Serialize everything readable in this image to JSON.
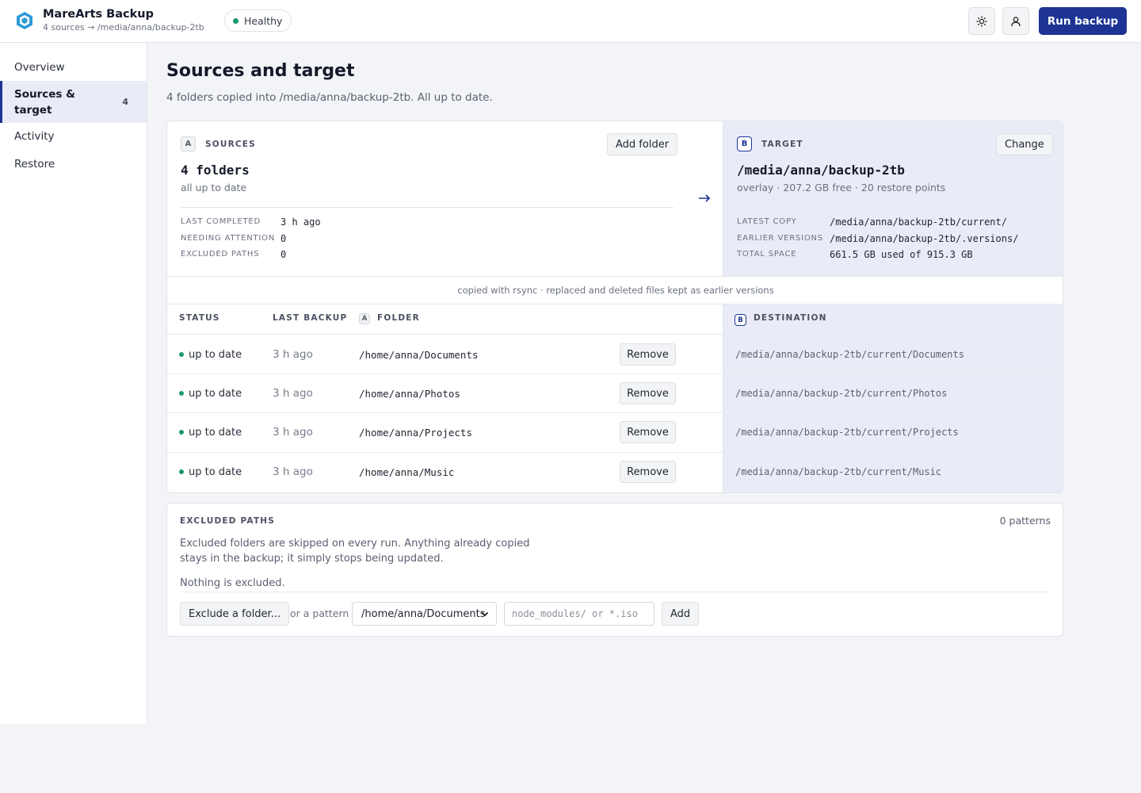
{
  "app": {
    "title": "MareArts Backup",
    "subtitle": "4 sources → /media/anna/backup-2tb",
    "health": "Healthy",
    "run_label": "Run backup"
  },
  "icons": {
    "logo": "cube-logo-icon",
    "theme": "sun-icon",
    "account": "user-icon",
    "arrow": "arrow-right-icon",
    "select": "chevron-down-icon"
  },
  "colors": {
    "accent": "#1d3494",
    "ok": "#1a9a6a",
    "target_bg": "#e9ecf6"
  },
  "sidebar": {
    "items": [
      {
        "label": "Overview"
      },
      {
        "label": "Sources & target",
        "count": "4"
      },
      {
        "label": "Activity"
      },
      {
        "label": "Restore"
      }
    ]
  },
  "page": {
    "title": "Sources and target",
    "subtitle": "4 folders copied into /media/anna/backup-2tb. All up to date."
  },
  "sources": {
    "badge": "A",
    "caption": "SOURCES",
    "add_label": "Add folder",
    "headline": "4 folders",
    "sub": "all up to date",
    "stats": [
      {
        "label": "LAST COMPLETED",
        "value": "3 h ago"
      },
      {
        "label": "NEEDING ATTENTION",
        "value": "0"
      },
      {
        "label": "EXCLUDED PATHS",
        "value": "0"
      }
    ]
  },
  "target": {
    "badge": "B",
    "caption": "TARGET",
    "change_label": "Change",
    "path": "/media/anna/backup-2tb",
    "sub": "overlay · 207.2 GB free · 20 restore points",
    "stats": [
      {
        "label": "LATEST COPY",
        "value": "/media/anna/backup-2tb/current/"
      },
      {
        "label": "EARLIER VERSIONS",
        "value": "/media/anna/backup-2tb/.versions/"
      },
      {
        "label": "TOTAL SPACE",
        "value": "661.5 GB used of 915.3 GB"
      }
    ]
  },
  "band_text": "copied with rsync · replaced and deleted files kept as earlier versions",
  "table": {
    "headers": {
      "status": "STATUS",
      "last_backup": "LAST BACKUP",
      "folder_badge": "A",
      "folder": "FOLDER",
      "dest_badge": "B",
      "destination": "DESTINATION"
    },
    "remove_label": "Remove",
    "rows": [
      {
        "status": "up to date",
        "last": "3 h ago",
        "folder": "/home/anna/Documents",
        "dest": "/media/anna/backup-2tb/current/Documents"
      },
      {
        "status": "up to date",
        "last": "3 h ago",
        "folder": "/home/anna/Photos",
        "dest": "/media/anna/backup-2tb/current/Photos"
      },
      {
        "status": "up to date",
        "last": "3 h ago",
        "folder": "/home/anna/Projects",
        "dest": "/media/anna/backup-2tb/current/Projects"
      },
      {
        "status": "up to date",
        "last": "3 h ago",
        "folder": "/home/anna/Music",
        "dest": "/media/anna/backup-2tb/current/Music"
      }
    ]
  },
  "excluded": {
    "caption": "EXCLUDED PATHS",
    "count": "0 patterns",
    "description": "Excluded folders are skipped on every run. Anything already copied stays in the backup; it simply stops being updated.",
    "empty": "Nothing is excluded.",
    "exclude_btn": "Exclude a folder...",
    "or_pattern": "or a pattern",
    "select_value": "/home/anna/Documents",
    "pattern_placeholder": "node_modules/ or *.iso",
    "add_label": "Add"
  }
}
